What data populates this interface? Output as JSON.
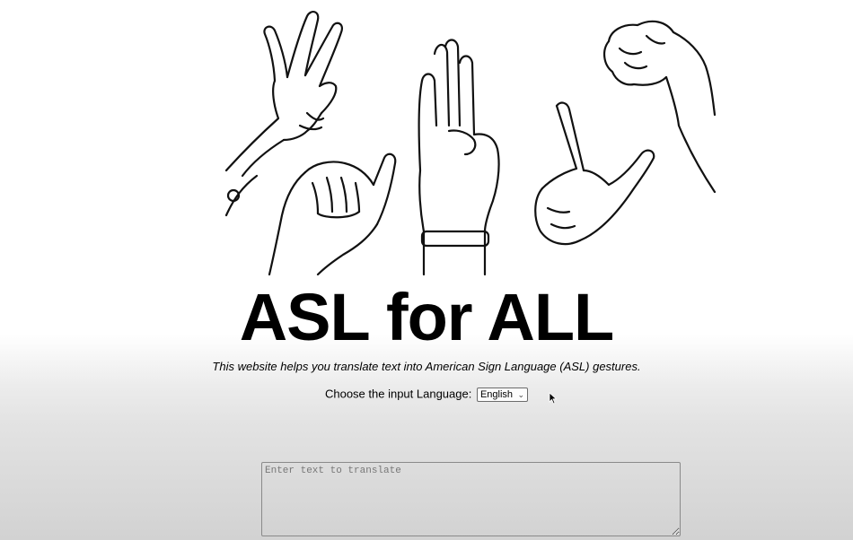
{
  "page": {
    "title": "ASL for ALL",
    "subtitle": "This website helps you translate text into American Sign Language (ASL) gestures."
  },
  "language": {
    "label": "Choose the input Language:",
    "selected": "English"
  },
  "input": {
    "placeholder": "Enter text to translate",
    "value": ""
  },
  "icons": {
    "hero": "asl-hands-illustration",
    "select_arrow": "chevron-down-icon",
    "pointer": "mouse-pointer-icon"
  }
}
